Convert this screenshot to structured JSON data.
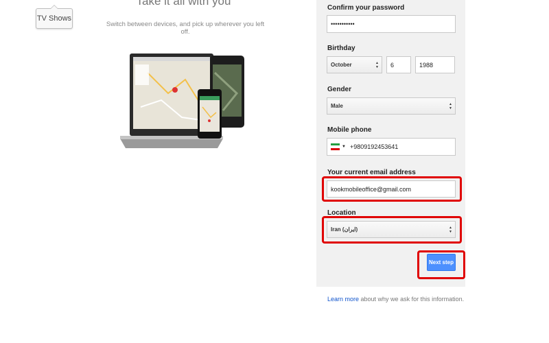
{
  "tooltip": {
    "label": "TV Shows"
  },
  "promo": {
    "title": "Take it all with you",
    "subtitle": "Switch between devices, and pick up wherever you left off."
  },
  "form": {
    "confirm_password": {
      "label": "Confirm your password",
      "value": "•••••••••••"
    },
    "birthday": {
      "label": "Birthday",
      "month": "October",
      "day": "6",
      "year": "1988"
    },
    "gender": {
      "label": "Gender",
      "value": "Male"
    },
    "mobile_phone": {
      "label": "Mobile phone",
      "value": "+9809192453641"
    },
    "email": {
      "label": "Your current email address",
      "value": "kookmobileoffice@gmail.com"
    },
    "location": {
      "label": "Location",
      "value": "Iran (‫ایران‬‎)"
    },
    "next_button": "Next step"
  },
  "footer": {
    "link": "Learn more",
    "text": " about why we ask for this information."
  },
  "colors": {
    "highlight": "#e00000",
    "button": "#4d90fe",
    "link": "#1155cc"
  }
}
